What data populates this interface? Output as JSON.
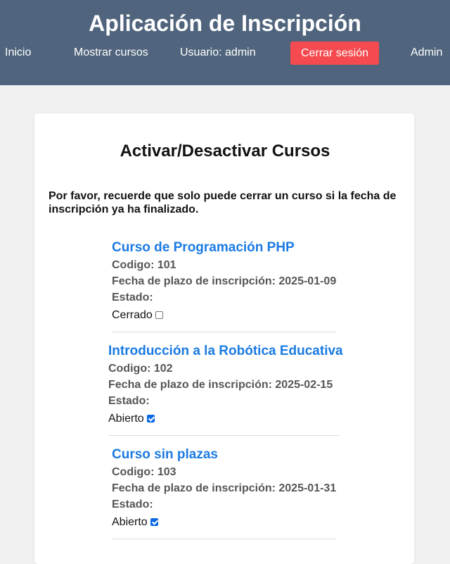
{
  "app": {
    "title": "Aplicación de Inscripción"
  },
  "nav": {
    "home": "Inicio",
    "show_courses": "Mostrar cursos",
    "user": "Usuario: admin",
    "logout": "Cerrar sesión",
    "admin": "Admin"
  },
  "page": {
    "title": "Activar/Desactivar Cursos",
    "notice": "Por favor, recuerde que solo puede cerrar un curso si la fecha de inscripción ya ha finalizado."
  },
  "courses": [
    {
      "name": "Curso de Programación PHP",
      "code_line": "Codigo: 101",
      "deadline_line": "Fecha de plazo de inscripción: 2025-01-09",
      "status_label": "Estado:",
      "status_value": "Cerrado",
      "checked": false
    },
    {
      "name": "Introducción a la Robótica Educativa",
      "code_line": "Codigo: 102",
      "deadline_line": "Fecha de plazo de inscripción: 2025-02-15",
      "status_label": "Estado:",
      "status_value": "Abierto",
      "checked": true
    },
    {
      "name": "Curso sin plazas",
      "code_line": "Codigo: 103",
      "deadline_line": "Fecha de plazo de inscripción: 2025-01-31",
      "status_label": "Estado:",
      "status_value": "Abierto",
      "checked": true
    }
  ],
  "colors": {
    "header_bg": "#50657d",
    "logout_bg": "#f54a4f",
    "link": "#1b7be3",
    "checkbox_checked": "#0b69e3"
  }
}
